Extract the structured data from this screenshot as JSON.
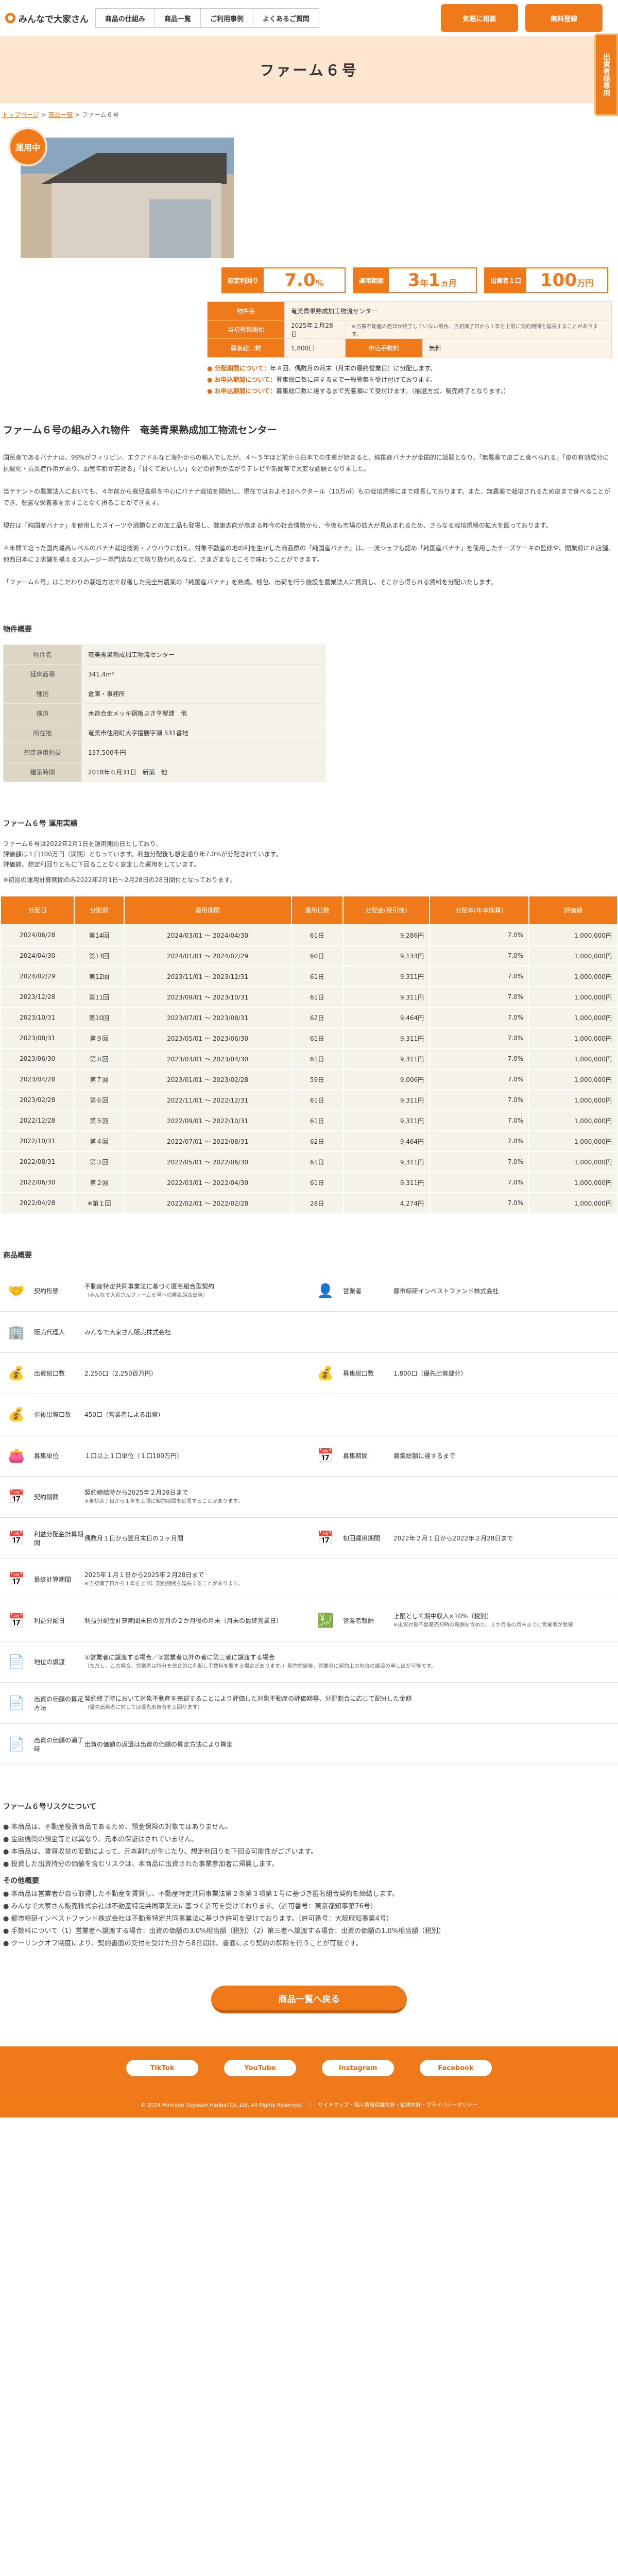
{
  "header": {
    "logo": "みんなで大家さん",
    "nav": [
      "商品の仕組み",
      "商品一覧",
      "ご利用事例",
      "よくあるご質問"
    ],
    "btn_consult": "気軽に相談",
    "btn_register": "無料登録"
  },
  "hero": {
    "title": "ファーム６号",
    "side_tab": "出資者様専用"
  },
  "breadcrumb": {
    "top": "トップページ",
    "list": "商品一覧",
    "current": "ファーム６号"
  },
  "status_badge": "運用中",
  "metrics": [
    {
      "label": "想定利回り",
      "value": "7.0",
      "unit": "%"
    },
    {
      "label": "運用期間",
      "value_a": "3",
      "unit_a": "年",
      "value_b": "1",
      "unit_b": "ヵ月"
    },
    {
      "label": "出資者１口",
      "value": "100",
      "unit": "万円"
    }
  ],
  "info": {
    "k_name": "物件名",
    "v_name": "奄美青果熟成加工物流センター",
    "k_start": "当初募集開始",
    "v_start": "2025年２月28日",
    "start_note": "※当事不動産の売却が終了していない場合、当初満了日から１年を上限に契約期間を延長することがあります。",
    "k_units": "募集総口数",
    "v_units": "1,800口",
    "k_fee": "申込手数料",
    "v_fee": "無料"
  },
  "notes": [
    {
      "k": "● 分配期間について：",
      "v": "年４回、偶数月の月末（月末の最終営業日）に分配します。"
    },
    {
      "k": "● お申込期間について：",
      "v": "募集総口数に達するまで一般募集を受け付けております。"
    },
    {
      "k": "● お申込期間について：",
      "v": "募集総口数に達するまで先着順にて受付けます。（抽選方式、販売終了となります。）"
    }
  ],
  "section_title": "ファーム６号の組み入れ物件　奄美青果熟成加工物流センター",
  "paragraphs": [
    "国民食であるバナナは、99%がフィリピン、エクアドルなど海外からの輸入でしたが、４～５年ほど前から日本での生産が始まると、純国産バナナが全国的に話題となり、「無農薬で皮ごと食べられる」「皮の有効成分に抗酸化・抗炎症作用があり、血管年齢が若返る」「甘くておいしい」などの評判が広がりテレビや新聞等で大変な話題となりました。",
    "当テナントの農業法人においても、４年前から鹿児島県を中心にバナナ栽培を開始し、現在ではおよそ10ヘクタール（10万㎡）もの栽培規模にまで成長しております。また、無農薬で栽培されるため皮まで食べることができ、豊富な栄養素を余すことなく摂ることができます。",
    "現在は「純国産バナナ」を使用したスイーツや酒類などの加工品も登場し、健康志向が高まる昨今の社会情勢から、今後も市場の拡大が見込まれるため、さらなる栽培規模の拡大を図っております。",
    "４年間で培った国内最高レベルのバナナ栽培技術・ノウハウに加え、対象不動産の地の利を生かした商品群の「純国産バナナ」は、一流シェフも認め「純国産バナナ」を使用したチーズケーキの監修や、開業前に８店舗、他西日本に２店舗を構えるスムージー専門店などで取り扱われるなど、さまざまなところで味わうことができます。",
    "「ファーム６号」はこだわりの栽培方法で収穫した完全無農薬の「純国産バナナ」を熟成、梱包、出荷を行う施設を農業法人に賃貸し、そこから得られる賃料を分配いたします。"
  ],
  "overview": {
    "title": "物件概要",
    "rows": [
      [
        "物件名",
        "奄美青果熟成加工物流センター"
      ],
      [
        "延床面積",
        "341.4m²"
      ],
      [
        "種別",
        "倉庫・事務所"
      ],
      [
        "構造",
        "木造合金メッキ鋼板ぶき平屋建　他"
      ],
      [
        "所在地",
        "奄美市住用町大字摺勝字瀬 531番地"
      ],
      [
        "想定運用利益",
        "137,500千円"
      ],
      [
        "建築時期",
        "2018年６月31日　新築　他"
      ]
    ]
  },
  "performance": {
    "title": "ファーム６号 運用実績",
    "lines": [
      "ファーム６号は2022年2月1日を運用開始日としており、",
      "評価額は１口100万円（満期）となっています。利益分配後も想定通り年7.0%が分配されています。",
      "評価額、想定利回りともに下回ることなく安定した運用をしています。",
      "※初回の運用計算期間のみ2022年2月1日〜2月28日の28日間付となっております。"
    ],
    "headers": [
      "分配日",
      "分配期",
      "運用期間",
      "運用日数",
      "分配金(税引後)",
      "分配率(年率換算)",
      "評価額"
    ],
    "rows": [
      [
        "2024/06/28",
        "第14回",
        "2024/03/01 ～ 2024/04/30",
        "61日",
        "9,286円",
        "7.0%",
        "1,000,000円"
      ],
      [
        "2024/04/30",
        "第13回",
        "2024/01/01 ～ 2024/02/29",
        "60日",
        "9,133円",
        "7.0%",
        "1,000,000円"
      ],
      [
        "2024/02/29",
        "第12回",
        "2023/11/01 ～ 2023/12/31",
        "61日",
        "9,311円",
        "7.0%",
        "1,000,000円"
      ],
      [
        "2023/12/28",
        "第11回",
        "2023/09/01 ～ 2023/10/31",
        "61日",
        "9,311円",
        "7.0%",
        "1,000,000円"
      ],
      [
        "2023/10/31",
        "第10回",
        "2023/07/01 ～ 2023/08/31",
        "62日",
        "9,464円",
        "7.0%",
        "1,000,000円"
      ],
      [
        "2023/08/31",
        "第９回",
        "2023/05/01 ～ 2023/06/30",
        "61日",
        "9,311円",
        "7.0%",
        "1,000,000円"
      ],
      [
        "2023/06/30",
        "第８回",
        "2023/03/01 ～ 2023/04/30",
        "61日",
        "9,311円",
        "7.0%",
        "1,000,000円"
      ],
      [
        "2023/04/28",
        "第７回",
        "2023/01/01 ～ 2023/02/28",
        "59日",
        "9,006円",
        "7.0%",
        "1,000,000円"
      ],
      [
        "2023/02/28",
        "第６回",
        "2022/11/01 ～ 2022/12/31",
        "61日",
        "9,311円",
        "7.0%",
        "1,000,000円"
      ],
      [
        "2022/12/28",
        "第５回",
        "2022/09/01 ～ 2022/10/31",
        "61日",
        "9,311円",
        "7.0%",
        "1,000,000円"
      ],
      [
        "2022/10/31",
        "第４回",
        "2022/07/01 ～ 2022/08/31",
        "62日",
        "9,464円",
        "7.0%",
        "1,000,000円"
      ],
      [
        "2022/08/31",
        "第３回",
        "2022/05/01 ～ 2022/06/30",
        "61日",
        "9,311円",
        "7.0%",
        "1,000,000円"
      ],
      [
        "2022/06/30",
        "第２回",
        "2022/03/01 ～ 2022/04/30",
        "61日",
        "9,311円",
        "7.0%",
        "1,000,000円"
      ],
      [
        "2022/04/28",
        "※第１回",
        "2022/02/01 ～ 2022/02/28",
        "28日",
        "4,274円",
        "7.0%",
        "1,000,000円"
      ]
    ]
  },
  "product": {
    "title": "商品概要",
    "cells": [
      {
        "icon": "handshake-icon",
        "glyph": "🤝",
        "k": "契約形態",
        "v": "不動産特定共同事業法に基づく匿名組合型契約",
        "s": "（みんなで大家さんファーム６号への匿名組合出資）"
      },
      {
        "icon": "person-icon",
        "glyph": "👤",
        "k": "営業者",
        "v": "都市綜研インベストファンド株式会社",
        "s": ""
      },
      {
        "icon": "building-icon",
        "glyph": "🏢",
        "k": "販売代理人",
        "v": "みんなで大家さん販売株式会社",
        "s": ""
      },
      {
        "icon": "blank",
        "glyph": "",
        "k": "",
        "v": "",
        "s": ""
      },
      {
        "icon": "coins-icon",
        "glyph": "💰",
        "k": "出資総口数",
        "v": "2,250口（2,250百万円）",
        "s": ""
      },
      {
        "icon": "coins-icon",
        "glyph": "💰",
        "k": "募集総口数",
        "v": "1,800口（優先出資部分）",
        "s": ""
      },
      {
        "icon": "coins-icon",
        "glyph": "💰",
        "k": "劣後出資口数",
        "v": "450口（営業者による出資）",
        "s": ""
      },
      {
        "icon": "blank",
        "glyph": "",
        "k": "",
        "v": "",
        "s": ""
      },
      {
        "icon": "wallet-icon",
        "glyph": "👛",
        "k": "募集単位",
        "v": "１口以上１口単位（１口100万円）",
        "s": ""
      },
      {
        "icon": "calendar-icon",
        "glyph": "📅",
        "k": "募集期間",
        "v": "募集総額に達するまで",
        "s": ""
      },
      {
        "icon": "calendar-icon",
        "glyph": "📅",
        "k": "契約期間",
        "v": "契約締結時から2025年２月28日まで",
        "s": "※当初満了日から１年を上限に契約期間を延長することがあります。"
      },
      {
        "icon": "blank",
        "glyph": "",
        "k": "",
        "v": "",
        "s": ""
      },
      {
        "icon": "calendar-icon",
        "glyph": "📅",
        "k": "利益分配金計算期間",
        "v": "偶数月１日から翌月末日の２ヶ月間",
        "s": ""
      },
      {
        "icon": "calendar-icon",
        "glyph": "📅",
        "k": "初回運用期間",
        "v": "2022年２月１日から2022年２月28日まで",
        "s": ""
      },
      {
        "icon": "calendar-icon",
        "glyph": "📅",
        "k": "最終計算期間",
        "v": "2025年１月１日から2025年２月28日まで",
        "s": "※当初満了日から１年を上限に契約期間を延長することがあります。"
      },
      {
        "icon": "blank",
        "glyph": "",
        "k": "",
        "v": "",
        "s": ""
      },
      {
        "icon": "calendar-icon",
        "glyph": "📅",
        "k": "利益分配日",
        "v": "利益分配金計算期間末日の翌月の２か月後の月末（月末の最終営業日）",
        "s": ""
      },
      {
        "icon": "percent-icon",
        "glyph": "💹",
        "k": "営業者報酬",
        "v": "上限として期中収入×10%（税別）",
        "s": "※出資対象不動産売却時の報酬を含めた、２か月後の月末までに営業者が受領"
      },
      {
        "icon": "document-icon",
        "glyph": "📄",
        "k": "地位の譲渡",
        "v": "①営業者に譲渡する場合／②営業者以外の者に第三者に譲渡する場合",
        "s": "（ただし、この場合、営業者は持分を総合的に判断し手数料を要する場合があります。）契約締結後、営業者に契約上の地位の譲渡の申し出が可能です。",
        "full": true
      },
      {
        "icon": "document-icon",
        "glyph": "📄",
        "k": "出資の価額の算定方法",
        "v": "契約終了時において対象不動産を売却することにより評価した対象不動産の評価額等、分配割合に応じて配分した金額",
        "s": "（優先出資者に対しては優先出資者を上回ります）",
        "full": true
      },
      {
        "icon": "document-icon",
        "glyph": "📄",
        "k": "出資の価額の適了時",
        "v": "出資の価額の返還は出資の価額の算定方法により算定",
        "s": "",
        "full": true
      }
    ]
  },
  "risk": {
    "title": "ファーム６号リスクについて",
    "lines": [
      "● 本商品は、不動産投資商品であるため、預金保険の対象ではありません。",
      "● 金融機関の預金等とは異なり、元本の保証はされていません。",
      "● 本商品は、賃貸収益の変動によって、元本割れが生じたり、想定利回りを下回る可能性がございます。",
      "● 投資した出資持分の価値を含むリスクは、本商品に出資された事業参加者に帰属します。"
    ],
    "title2": "その他概要",
    "lines2": [
      "● 本商品は営業者が自ら取得した不動産を賃貸し、不動産特定共同事業法第２条第３項第１号に基づき匿名組合契約を締結します。",
      "● みんなで大家さん販売株式会社は不動産特定共同事業法に基づく許可を受けております。（許可番号：東京都知事第76号）",
      "● 都市綜研インベストファンド株式会社は不動産特定共同事業法に基づき許可を受けております。（許可番号：大阪府知事第4号）",
      "● 手数料について（1）営業者へ譲渡する場合：出資の価額の3.0%相当額（税別）（2）第三者へ譲渡する場合：出資の価額の1.0%相当額（税別）",
      "● クーリングオフ制度により、契約書面の交付を受けた日から8日間は、書面により契約の解除を行うことが可能です。"
    ]
  },
  "back_button": "商品一覧へ戻る",
  "footer": {
    "sns": [
      "TikTok",
      "YouTube",
      "Instagram",
      "Facebook"
    ],
    "copyright": "© 2024 Minnade Ooyasan Hanbai Co.,Ltd. All Rights Reserved.　｜　サイトマップ・個人情報保護方針・勧誘方針・プライバシーポリシー"
  }
}
